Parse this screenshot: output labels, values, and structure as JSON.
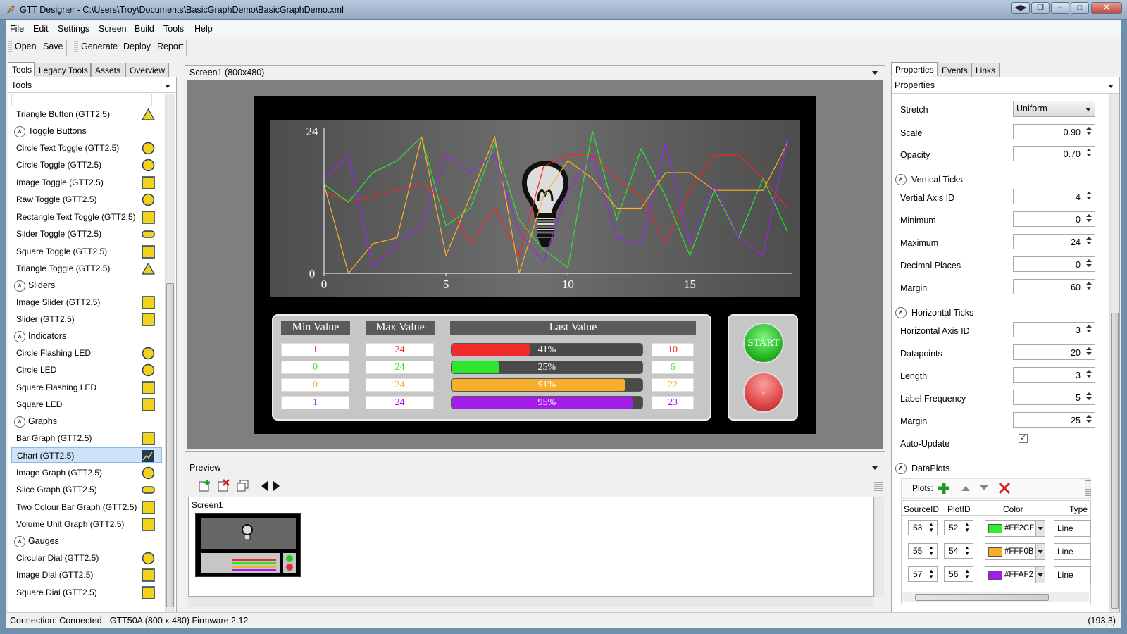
{
  "window": {
    "title": "GTT Designer - C:\\Users\\Troy\\Documents\\BasicGraphDemo\\BasicGraphDemo.xml"
  },
  "menu": [
    "File",
    "Edit",
    "Settings",
    "Screen",
    "Build",
    "Tools",
    "Help"
  ],
  "toolbar": {
    "open": "Open",
    "save": "Save",
    "generate": "Generate",
    "deploy": "Deploy",
    "report": "Report"
  },
  "left_tabs": [
    "Tools",
    "Legacy Tools",
    "Assets",
    "Overview"
  ],
  "tools_combo": "Tools",
  "tools": [
    {
      "kind": "item",
      "label": "Triangle Button (GTT2.5)",
      "icon": "triangle-icon"
    },
    {
      "kind": "cat",
      "label": "Toggle Buttons"
    },
    {
      "kind": "item",
      "label": "Circle Text Toggle (GTT2.5)",
      "icon": "circle-text-icon"
    },
    {
      "kind": "item",
      "label": "Circle Toggle (GTT2.5)",
      "icon": "circle-toggle-icon"
    },
    {
      "kind": "item",
      "label": "Image Toggle (GTT2.5)",
      "icon": "image-icon"
    },
    {
      "kind": "item",
      "label": "Raw Toggle (GTT2.5)",
      "icon": "raw-toggle-icon"
    },
    {
      "kind": "item",
      "label": "Rectangle Text Toggle (GTT2.5)",
      "icon": "rect-text-icon"
    },
    {
      "kind": "item",
      "label": "Slider Toggle (GTT2.5)",
      "icon": "slider-toggle-icon"
    },
    {
      "kind": "item",
      "label": "Square Toggle (GTT2.5)",
      "icon": "square-toggle-icon"
    },
    {
      "kind": "item",
      "label": "Triangle Toggle (GTT2.5)",
      "icon": "triangle-icon"
    },
    {
      "kind": "cat",
      "label": "Sliders"
    },
    {
      "kind": "item",
      "label": "Image Slider (GTT2.5)",
      "icon": "image-slider-icon"
    },
    {
      "kind": "item",
      "label": "Slider (GTT2.5)",
      "icon": "slider-icon"
    },
    {
      "kind": "cat",
      "label": "Indicators"
    },
    {
      "kind": "item",
      "label": "Circle Flashing LED",
      "icon": "flashing-led-icon"
    },
    {
      "kind": "item",
      "label": "Circle LED",
      "icon": "led-icon"
    },
    {
      "kind": "item",
      "label": "Square Flashing LED",
      "icon": "square-flashing-led-icon"
    },
    {
      "kind": "item",
      "label": "Square LED",
      "icon": "square-led-icon"
    },
    {
      "kind": "cat",
      "label": "Graphs"
    },
    {
      "kind": "item",
      "label": "Bar Graph (GTT2.5)",
      "icon": "bar-graph-icon"
    },
    {
      "kind": "item",
      "label": "Chart (GTT2.5)",
      "icon": "chart-icon",
      "selected": true
    },
    {
      "kind": "item",
      "label": "Image Graph (GTT2.5)",
      "icon": "thermometer-icon"
    },
    {
      "kind": "item",
      "label": "Slice Graph (GTT2.5)",
      "icon": "slice-graph-icon"
    },
    {
      "kind": "item",
      "label": "Two Colour Bar Graph (GTT2.5)",
      "icon": "two-colour-bar-icon"
    },
    {
      "kind": "item",
      "label": "Volume Unit Graph (GTT2.5)",
      "icon": "volume-unit-icon"
    },
    {
      "kind": "cat",
      "label": "Gauges"
    },
    {
      "kind": "item",
      "label": "Circular Dial (GTT2.5)",
      "icon": "circular-dial-icon"
    },
    {
      "kind": "item",
      "label": "Image Dial (GTT2.5)",
      "icon": "image-dial-icon"
    },
    {
      "kind": "item",
      "label": "Square Dial (GTT2.5)",
      "icon": "square-dial-icon"
    }
  ],
  "screen_panel": {
    "title": "Screen1 (800x480)"
  },
  "chart_data": {
    "type": "line",
    "x": [
      0,
      1,
      2,
      3,
      4,
      5,
      6,
      7,
      8,
      9,
      10,
      11,
      12,
      13,
      14,
      15,
      16,
      17,
      18,
      19
    ],
    "xticks": [
      0,
      5,
      10,
      15
    ],
    "yticks": [
      0,
      24
    ],
    "xlim": [
      0,
      19
    ],
    "ylim": [
      0,
      24
    ],
    "series": [
      {
        "color": "#FF2020",
        "values": [
          14,
          12,
          13,
          14,
          15,
          12,
          5,
          11,
          3,
          18,
          20,
          20,
          16,
          13,
          5,
          14,
          20,
          20,
          16,
          11
        ]
      },
      {
        "color": "#2CE82C",
        "values": [
          15,
          12,
          17,
          19,
          23,
          8,
          11,
          22,
          9,
          4,
          1,
          24,
          9,
          21,
          13,
          3,
          14,
          6,
          16,
          7
        ]
      },
      {
        "color": "#FFB02A",
        "values": [
          15,
          0,
          5,
          6,
          23,
          3,
          13,
          23,
          0,
          13,
          19,
          16,
          11,
          11,
          17,
          17,
          14,
          14,
          14,
          22
        ]
      },
      {
        "color": "#A020F0",
        "values": [
          16,
          20,
          1,
          5,
          8,
          20,
          17,
          20,
          7,
          2,
          14,
          20,
          6,
          5,
          22,
          5,
          15,
          6,
          3,
          23
        ]
      }
    ]
  },
  "table": {
    "headers": {
      "min": "Min Value",
      "max": "Max Value",
      "last": "Last Value"
    },
    "rows": [
      {
        "min": "1",
        "max": "24",
        "pct": "41%",
        "fill": 0.41,
        "last": "10",
        "color": "#F22C2C"
      },
      {
        "min": "0",
        "max": "24",
        "pct": "25%",
        "fill": 0.25,
        "last": "6",
        "color": "#2CE62C"
      },
      {
        "min": "0",
        "max": "24",
        "pct": "91%",
        "fill": 0.91,
        "last": "22",
        "color": "#F7AE2A"
      },
      {
        "min": "1",
        "max": "24",
        "pct": "95%",
        "fill": 0.95,
        "last": "23",
        "color": "#A21EE8"
      }
    ]
  },
  "buttons": {
    "start": "START",
    "stop": "-"
  },
  "preview": {
    "title": "Preview",
    "screen_label": "Screen1"
  },
  "right_tabs": [
    "Properties",
    "Events",
    "Links"
  ],
  "properties_header": "Properties",
  "props": {
    "stretch_label": "Stretch",
    "stretch_value": "Uniform",
    "scale_label": "Scale",
    "scale_value": "0.90",
    "opacity_label": "Opacity",
    "opacity_value": "0.70",
    "vt_section": "Vertical Ticks",
    "vaxis_label": "Vertial Axis ID",
    "vaxis_value": "4",
    "min_label": "Minimum",
    "min_value": "0",
    "max_label": "Maximum",
    "max_value": "24",
    "dec_label": "Decimal Places",
    "dec_value": "0",
    "vmargin_label": "Margin",
    "vmargin_value": "60",
    "ht_section": "Horizontal Ticks",
    "haxis_label": "Horizontal Axis ID",
    "haxis_value": "3",
    "dp_label": "Datapoints",
    "dp_value": "20",
    "len_label": "Length",
    "len_value": "3",
    "lf_label": "Label Frequency",
    "lf_value": "5",
    "hmargin_label": "Margin",
    "hmargin_value": "25",
    "au_label": "Auto-Update",
    "dataplots_section": "DataPlots",
    "plots_label": "Plots:"
  },
  "dataplots": {
    "headers": {
      "source": "SourceID",
      "plot": "PlotID",
      "color": "Color",
      "type": "Type"
    },
    "rows": [
      {
        "source": "53",
        "plot": "52",
        "swatch": "#2CF22C",
        "color": "#FF2CF",
        "type": "Line"
      },
      {
        "source": "55",
        "plot": "54",
        "swatch": "#F7AE2A",
        "color": "#FFF0B",
        "type": "Line"
      },
      {
        "source": "57",
        "plot": "56",
        "swatch": "#A21EE8",
        "color": "#FFAF2",
        "type": "Line"
      }
    ]
  },
  "status": {
    "connection": "Connection: Connected - GTT50A (800 x 480) Firmware 2.12",
    "coords": "(193,3)"
  }
}
